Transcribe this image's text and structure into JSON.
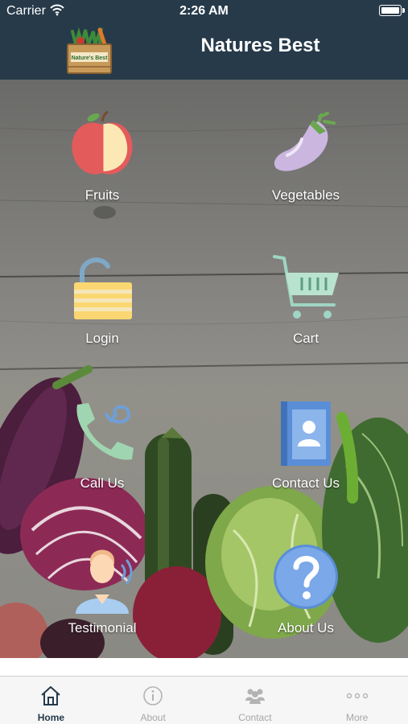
{
  "status_bar": {
    "carrier": "Carrier",
    "time": "2:26 AM"
  },
  "nav": {
    "title": "Natures Best",
    "logo_text": "Nature's Best"
  },
  "tiles": [
    {
      "label": "Fruits",
      "icon": "apple-icon"
    },
    {
      "label": "Vegetables",
      "icon": "eggplant-icon"
    },
    {
      "label": "Login",
      "icon": "padlock-icon"
    },
    {
      "label": "Cart",
      "icon": "cart-icon"
    },
    {
      "label": "Call Us",
      "icon": "phone-icon"
    },
    {
      "label": "Contact Us",
      "icon": "contact-book-icon"
    },
    {
      "label": "Testimonial",
      "icon": "person-speaking-icon"
    },
    {
      "label": "About Us",
      "icon": "question-icon"
    }
  ],
  "tabs": [
    {
      "label": "Home",
      "icon": "home-icon",
      "active": true
    },
    {
      "label": "About",
      "icon": "info-icon",
      "active": false
    },
    {
      "label": "Contact",
      "icon": "people-icon",
      "active": false
    },
    {
      "label": "More",
      "icon": "more-dots-icon",
      "active": false
    }
  ],
  "colors": {
    "nav_background": "#263a4a",
    "tab_active": "#263a4a",
    "tab_inactive": "#a6a6a6"
  }
}
